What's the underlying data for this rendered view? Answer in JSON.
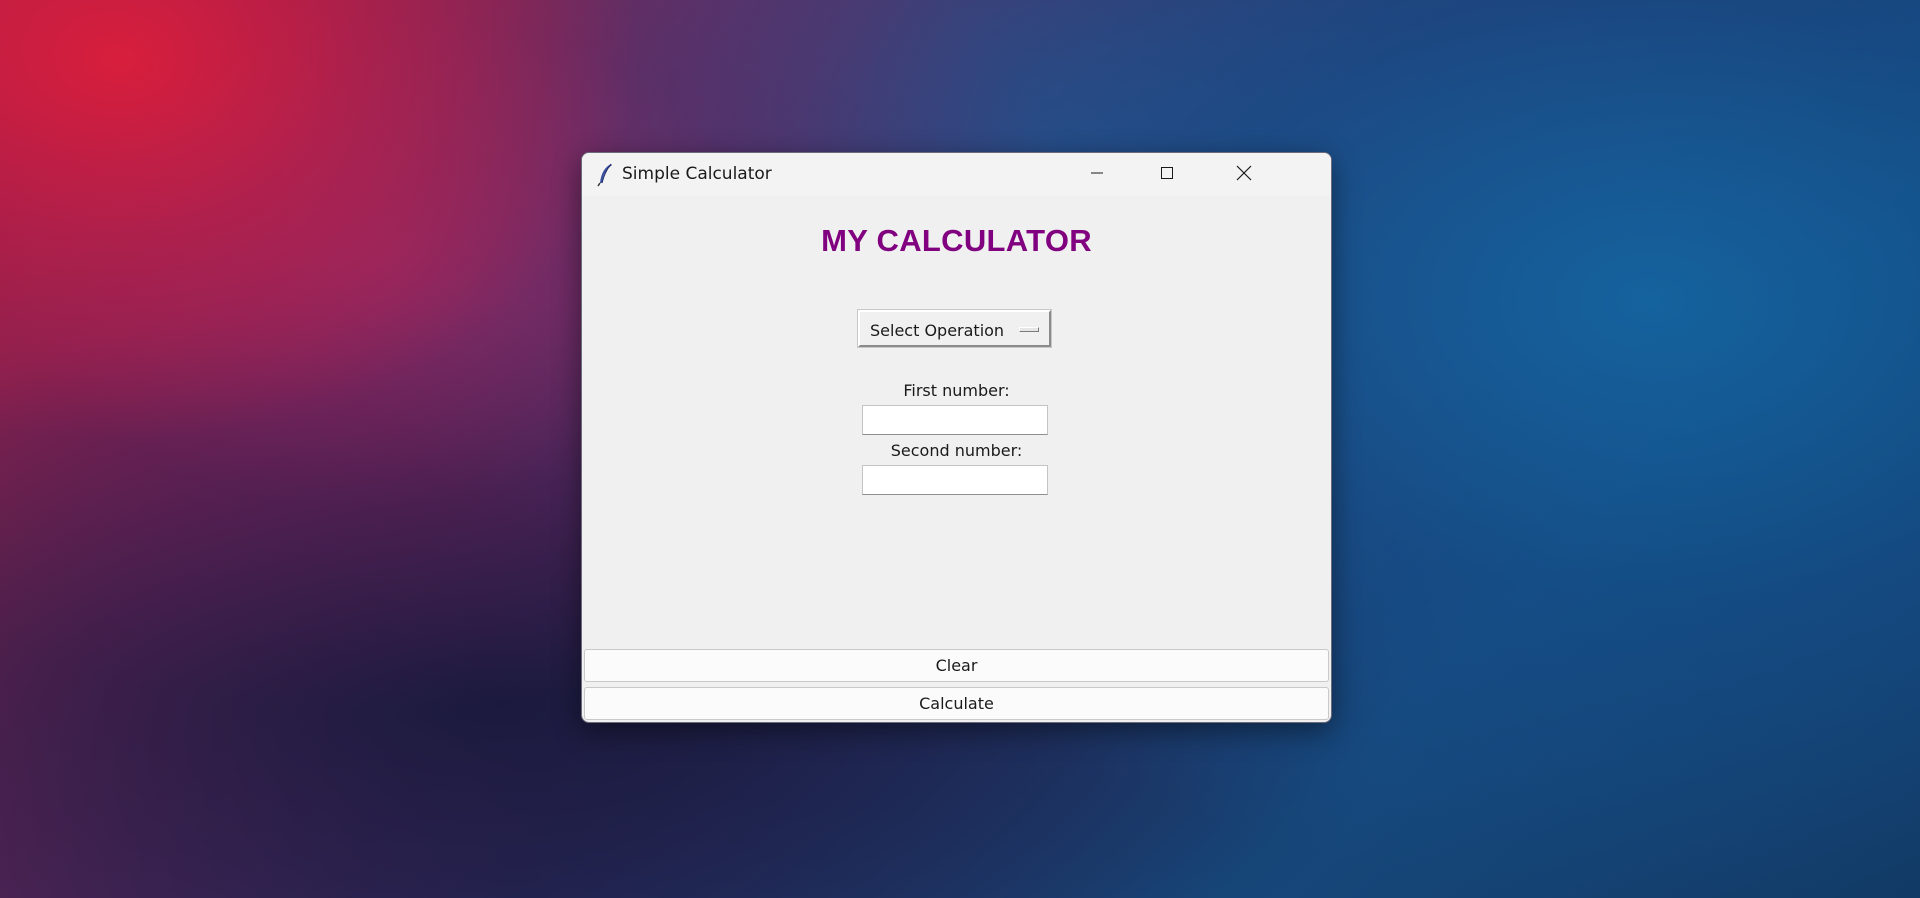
{
  "window": {
    "title": "Simple Calculator",
    "app_icon": "feather-icon",
    "controls": {
      "minimize_icon": "minimize-icon",
      "maximize_icon": "maximize-icon",
      "close_icon": "close-icon"
    }
  },
  "main": {
    "heading": "MY CALCULATOR",
    "heading_color": "#800080",
    "operation_menu": {
      "selected": "Select Operation"
    },
    "first_number": {
      "label": "First number:",
      "value": ""
    },
    "second_number": {
      "label": "Second number:",
      "value": ""
    }
  },
  "buttons": {
    "clear_label": "Clear",
    "calculate_label": "Calculate"
  }
}
